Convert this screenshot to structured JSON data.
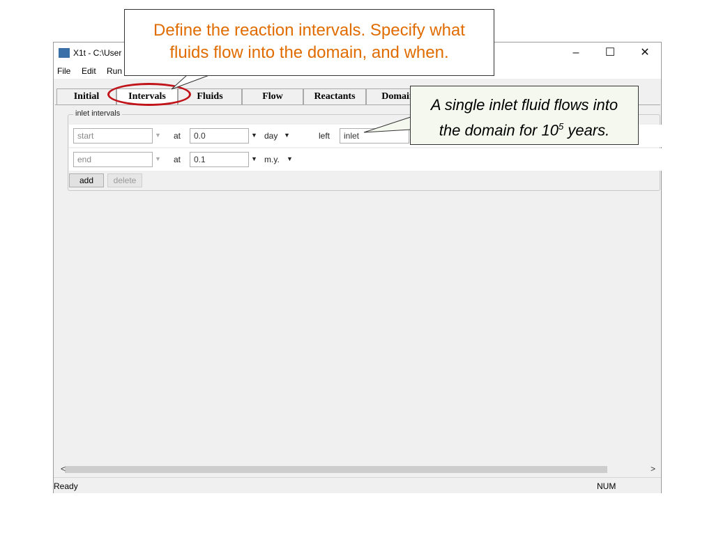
{
  "window": {
    "title": "X1t - C:\\User",
    "controls": {
      "minimize": "–",
      "maximize": "☐",
      "close": "✕"
    }
  },
  "menu": {
    "items": [
      "File",
      "Edit",
      "Run"
    ]
  },
  "tabs": [
    {
      "label": "Initial",
      "active": false
    },
    {
      "label": "Intervals",
      "active": true
    },
    {
      "label": "Fluids",
      "active": false
    },
    {
      "label": "Flow",
      "active": false
    },
    {
      "label": "Reactants",
      "active": false
    },
    {
      "label": "Domain",
      "active": false
    }
  ],
  "inlet_intervals": {
    "group_label": "inlet intervals",
    "rows": [
      {
        "name": "start",
        "at_label": "at",
        "value": "0.0",
        "unit": "day",
        "side_label": "left",
        "fluid": "inlet"
      },
      {
        "name": "end",
        "at_label": "at",
        "value": "0.1",
        "unit": "m.y.",
        "side_label": "",
        "fluid": ""
      }
    ],
    "add_label": "add",
    "delete_label": "delete"
  },
  "scrollbar": {
    "left_arrow": "<",
    "right_arrow": ">"
  },
  "statusbar": {
    "status": "Ready",
    "num": "NUM"
  },
  "callouts": {
    "top": {
      "line1": "Define the reaction intervals. Specify what",
      "line2": "fluids flow into the domain, and when."
    },
    "right": {
      "line1": "A single inlet fluid flows into",
      "line2_pre": "the domain for 10",
      "line2_sup": "5",
      "line2_post": " years."
    }
  },
  "colors": {
    "callout_text": "#e06c00",
    "highlight_ring": "#c0141a",
    "note_bg": "#f5f8ee"
  }
}
